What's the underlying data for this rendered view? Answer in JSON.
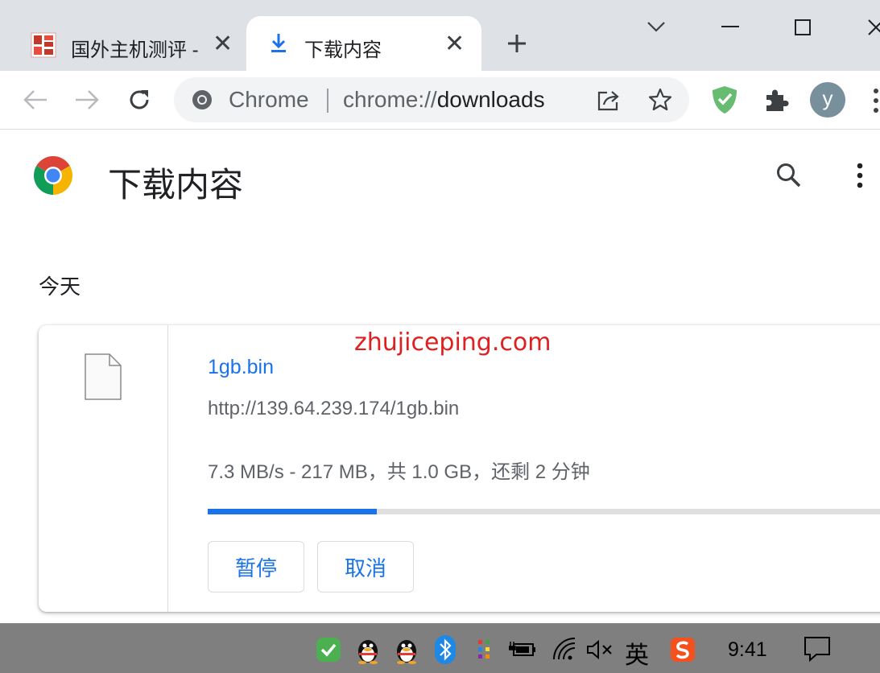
{
  "tabs": [
    {
      "title": "国外主机测评 - ",
      "active": false
    },
    {
      "title": "下载内容",
      "active": true
    }
  ],
  "window_controls": {
    "minimize": "—",
    "maximize": "☐",
    "close": "✕"
  },
  "omnibox": {
    "site_label": "Chrome",
    "url_prefix": "chrome://",
    "url_path": "downloads"
  },
  "profile": {
    "initial": "y"
  },
  "page": {
    "title": "下载内容",
    "section_label": "今天"
  },
  "download": {
    "filename": "1gb.bin",
    "url": "http://139.64.239.174/1gb.bin",
    "status": "7.3 MB/s - 217 MB，共 1.0 GB，还剩 2 分钟",
    "progress": 0.25,
    "pause_label": "暂停",
    "cancel_label": "取消"
  },
  "watermark": "zhujiceping.com",
  "taskbar": {
    "ime_label": "英",
    "time": "9:41"
  },
  "colors": {
    "accent": "#1a73e8",
    "tabstrip": "#dee1e6",
    "taskbar": "#7f7f7f",
    "watermark": "#e02020"
  }
}
